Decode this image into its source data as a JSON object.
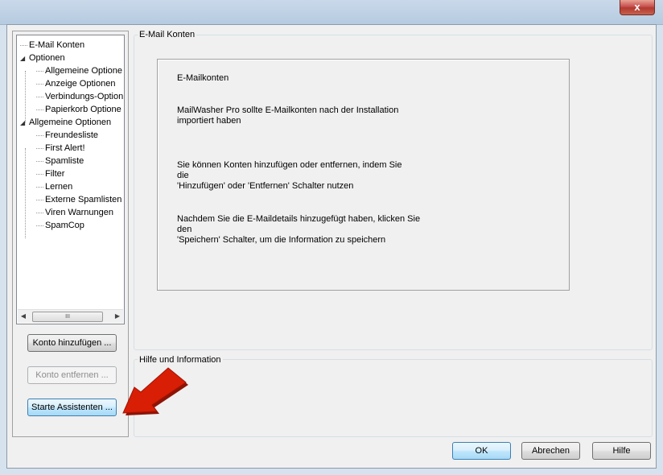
{
  "window": {
    "close_label": "x"
  },
  "tree": {
    "items": [
      {
        "label": "E-Mail Konten",
        "level": 0,
        "expander": ""
      },
      {
        "label": "Optionen",
        "level": 0,
        "expander": "◢"
      },
      {
        "label": "Allgemeine Optione",
        "level": 1,
        "expander": ""
      },
      {
        "label": "Anzeige Optionen",
        "level": 1,
        "expander": ""
      },
      {
        "label": "Verbindungs-Option",
        "level": 1,
        "expander": ""
      },
      {
        "label": "Papierkorb Optione",
        "level": 1,
        "expander": ""
      },
      {
        "label": "Allgemeine Optionen",
        "level": 0,
        "expander": "◢"
      },
      {
        "label": "Freundesliste",
        "level": 1,
        "expander": ""
      },
      {
        "label": "First Alert!",
        "level": 1,
        "expander": ""
      },
      {
        "label": "Spamliste",
        "level": 1,
        "expander": ""
      },
      {
        "label": "Filter",
        "level": 1,
        "expander": ""
      },
      {
        "label": "Lernen",
        "level": 1,
        "expander": ""
      },
      {
        "label": "Externe Spamlisten",
        "level": 1,
        "expander": ""
      },
      {
        "label": "Viren Warnungen",
        "level": 1,
        "expander": ""
      },
      {
        "label": "SpamCop",
        "level": 1,
        "expander": ""
      }
    ],
    "scroll_left": "◀",
    "scroll_right": "▶",
    "scroll_thumb": "III"
  },
  "buttons": {
    "add_account": "Konto hinzufügen ...",
    "remove_account": "Konto entfernen ...",
    "start_wizard": "Starte Assistenten ...",
    "ok": "OK",
    "cancel": "Abrechen",
    "help": "Hilfe"
  },
  "email_group": {
    "title": "E-Mail Konten",
    "heading": "E-Mailkonten",
    "para1": "MailWasher Pro sollte E-Mailkonten nach der Installation\nimportiert haben",
    "para2": "Sie können Konten hinzufügen oder entfernen, indem Sie\ndie\n 'Hinzufügen' oder 'Entfernen' Schalter nutzen",
    "para3": "Nachdem Sie die E-Maildetails hinzugefügt haben, klicken Sie\nden\n 'Speichern' Schalter, um die Information zu speichern"
  },
  "help_group": {
    "title": "Hilfe und Information"
  },
  "colors": {
    "arrow": "#d81e05",
    "focus_border": "#3c7fb1"
  }
}
